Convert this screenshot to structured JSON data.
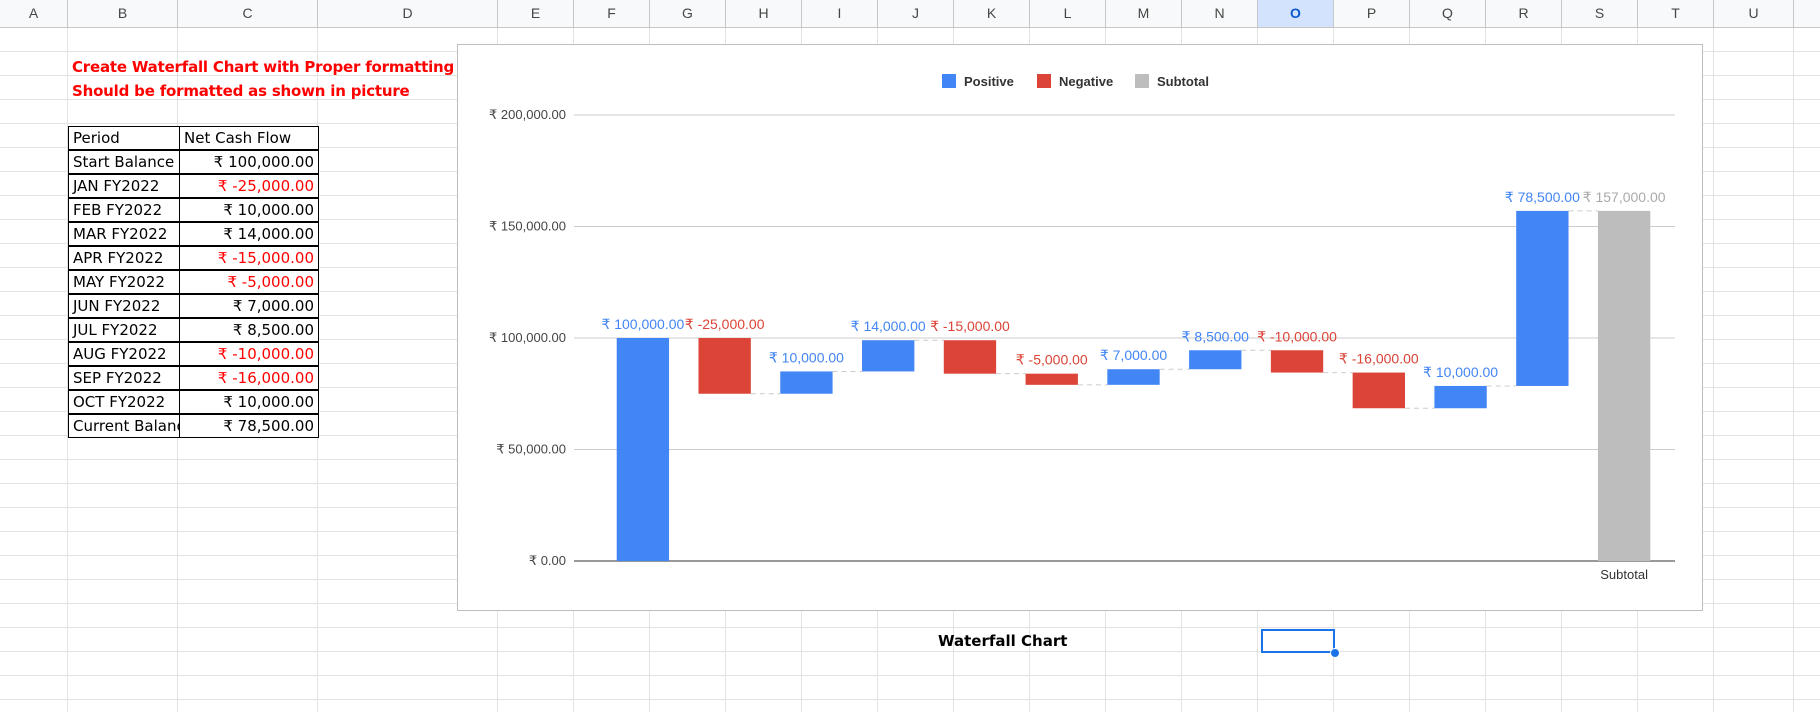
{
  "columns": [
    "A",
    "B",
    "C",
    "D",
    "E",
    "F",
    "G",
    "H",
    "I",
    "J",
    "K",
    "L",
    "M",
    "N",
    "O",
    "P",
    "Q",
    "R",
    "S",
    "T",
    "U"
  ],
  "selected_column": "O",
  "notes": [
    "Create Waterfall Chart with Proper formatting",
    "Should be formatted as shown in picture"
  ],
  "table": {
    "headers": [
      "Period",
      "Net Cash Flow"
    ],
    "rows": [
      {
        "period": "Start Balance",
        "value": "₹ 100,000.00",
        "negative": false
      },
      {
        "period": "JAN FY2022",
        "value": "₹ -25,000.00",
        "negative": true
      },
      {
        "period": "FEB FY2022",
        "value": "₹ 10,000.00",
        "negative": false
      },
      {
        "period": "MAR FY2022",
        "value": "₹ 14,000.00",
        "negative": false
      },
      {
        "period": "APR FY2022",
        "value": "₹ -15,000.00",
        "negative": true
      },
      {
        "period": "MAY FY2022",
        "value": "₹ -5,000.00",
        "negative": true
      },
      {
        "period": "JUN FY2022",
        "value": "₹ 7,000.00",
        "negative": false
      },
      {
        "period": "JUL FY2022",
        "value": "₹ 8,500.00",
        "negative": false
      },
      {
        "period": "AUG FY2022",
        "value": "₹ -10,000.00",
        "negative": true
      },
      {
        "period": "SEP FY2022",
        "value": "₹ -16,000.00",
        "negative": true
      },
      {
        "period": "OCT FY2022",
        "value": "₹ 10,000.00",
        "negative": false
      },
      {
        "period": "Current Balance",
        "value": "₹ 78,500.00",
        "negative": false
      }
    ]
  },
  "chart_caption": "Waterfall Chart",
  "chart_data": {
    "type": "bar",
    "subtype": "waterfall",
    "legend": [
      {
        "name": "Positive",
        "color": "#4285f4"
      },
      {
        "name": "Negative",
        "color": "#db4437"
      },
      {
        "name": "Subtotal",
        "color": "#bdbdbd"
      }
    ],
    "legend_position": "top",
    "ylim": [
      0,
      200000
    ],
    "yticks": [
      0,
      50000,
      100000,
      150000,
      200000
    ],
    "ytick_labels": [
      "₹ 0.00",
      "₹ 50,000.00",
      "₹ 100,000.00",
      "₹ 150,000.00",
      "₹ 200,000.00"
    ],
    "gridlines": true,
    "subtotal_label": "Subtotal",
    "steps": [
      {
        "value": 100000,
        "label": "₹ 100,000.00"
      },
      {
        "value": -25000,
        "label": "₹ -25,000.00"
      },
      {
        "value": 10000,
        "label": "₹ 10,000.00"
      },
      {
        "value": 14000,
        "label": "₹ 14,000.00"
      },
      {
        "value": -15000,
        "label": "₹ -15,000.00"
      },
      {
        "value": -5000,
        "label": "₹ -5,000.00"
      },
      {
        "value": 7000,
        "label": "₹ 7,000.00"
      },
      {
        "value": 8500,
        "label": "₹ 8,500.00"
      },
      {
        "value": -10000,
        "label": "₹ -10,000.00"
      },
      {
        "value": -16000,
        "label": "₹ -16,000.00"
      },
      {
        "value": 10000,
        "label": "₹ 10,000.00"
      },
      {
        "value": 78500,
        "label": "₹ 78,500.00"
      }
    ],
    "subtotal": {
      "value": 157000,
      "label": "₹ 157,000.00"
    }
  }
}
